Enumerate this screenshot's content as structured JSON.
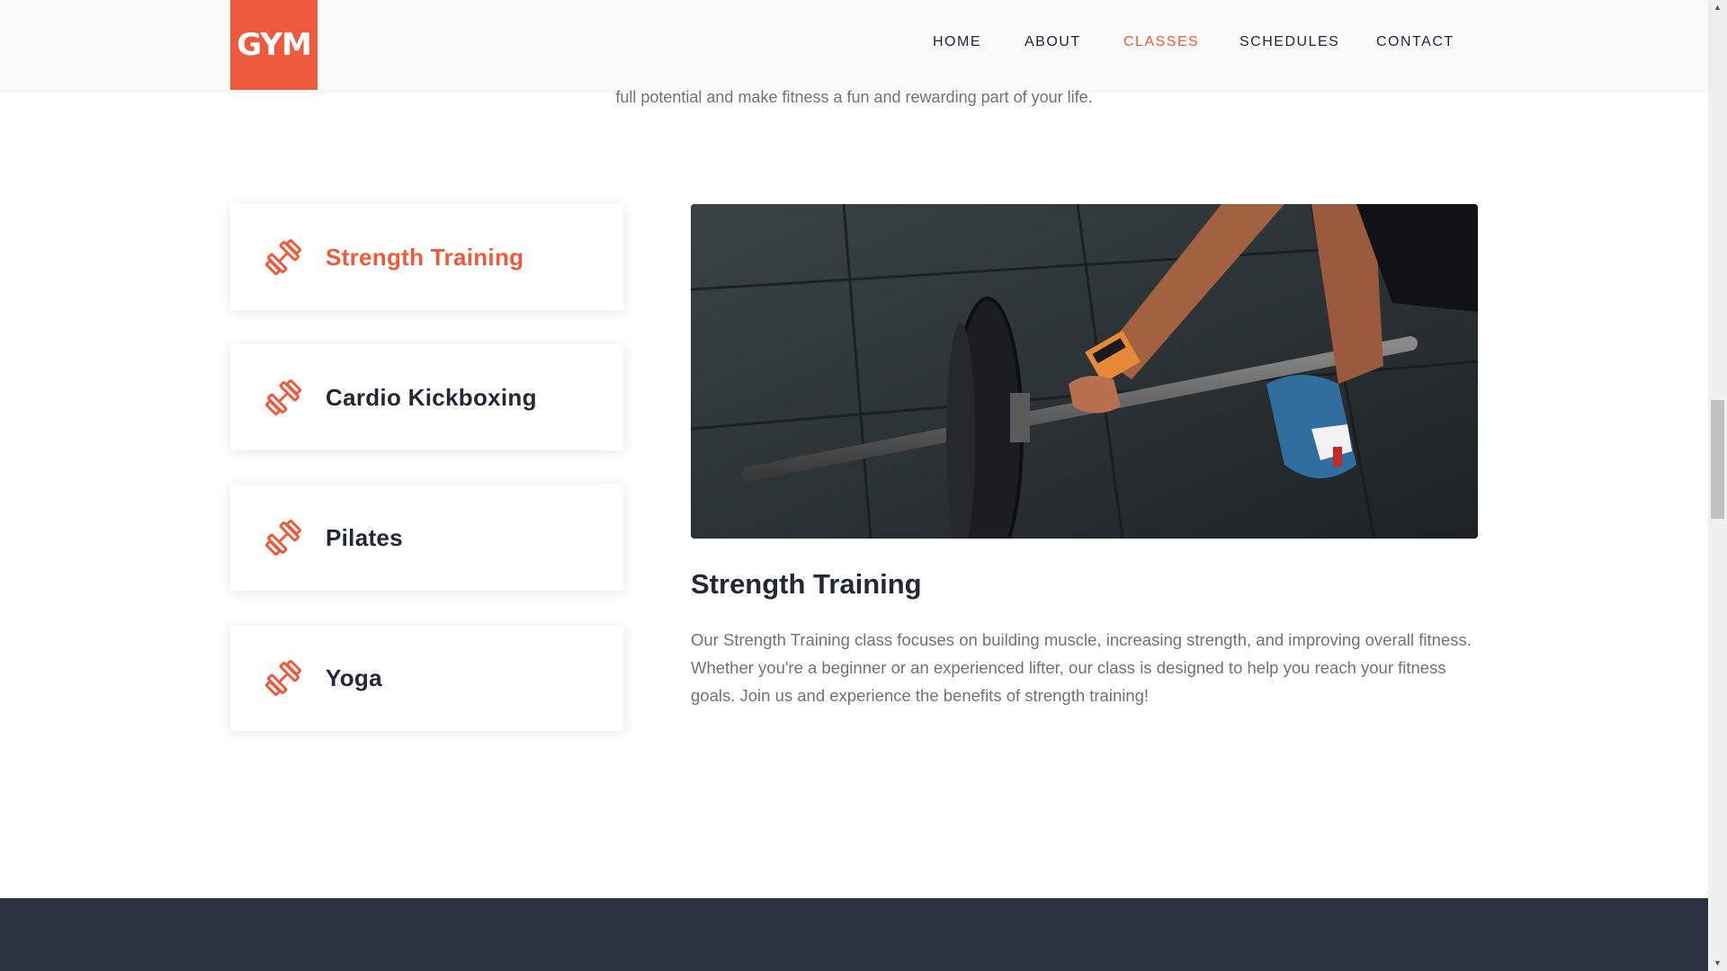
{
  "header": {
    "logo_text": "GYM",
    "nav": [
      {
        "label": "HOME",
        "active": false
      },
      {
        "label": "ABOUT",
        "active": false
      },
      {
        "label": "CLASSES",
        "active": true
      },
      {
        "label": "SCHEDULES",
        "active": false
      },
      {
        "label": "CONTACT",
        "active": false
      }
    ]
  },
  "intro": {
    "text_tail": "full potential and make fitness a fun and rewarding part of your life."
  },
  "classes": {
    "items": [
      {
        "label": "Strength Training",
        "icon": "dumbbell-icon",
        "active": true
      },
      {
        "label": "Cardio Kickboxing",
        "icon": "dumbbell-icon",
        "active": false
      },
      {
        "label": "Pilates",
        "icon": "dumbbell-icon",
        "active": false
      },
      {
        "label": "Yoga",
        "icon": "dumbbell-icon",
        "active": false
      }
    ],
    "detail": {
      "title": "Strength Training",
      "description": "Our Strength Training class focuses on building muscle, increasing strength, and improving overall fitness. Whether you're a beginner or an experienced lifter, our class is designed to help you reach your fitness goals. Join us and experience the benefits of strength training!"
    }
  },
  "colors": {
    "accent": "#ee5a3c",
    "heading": "#232838",
    "body_text": "#6f7277",
    "footer_band": "#2b3140"
  }
}
